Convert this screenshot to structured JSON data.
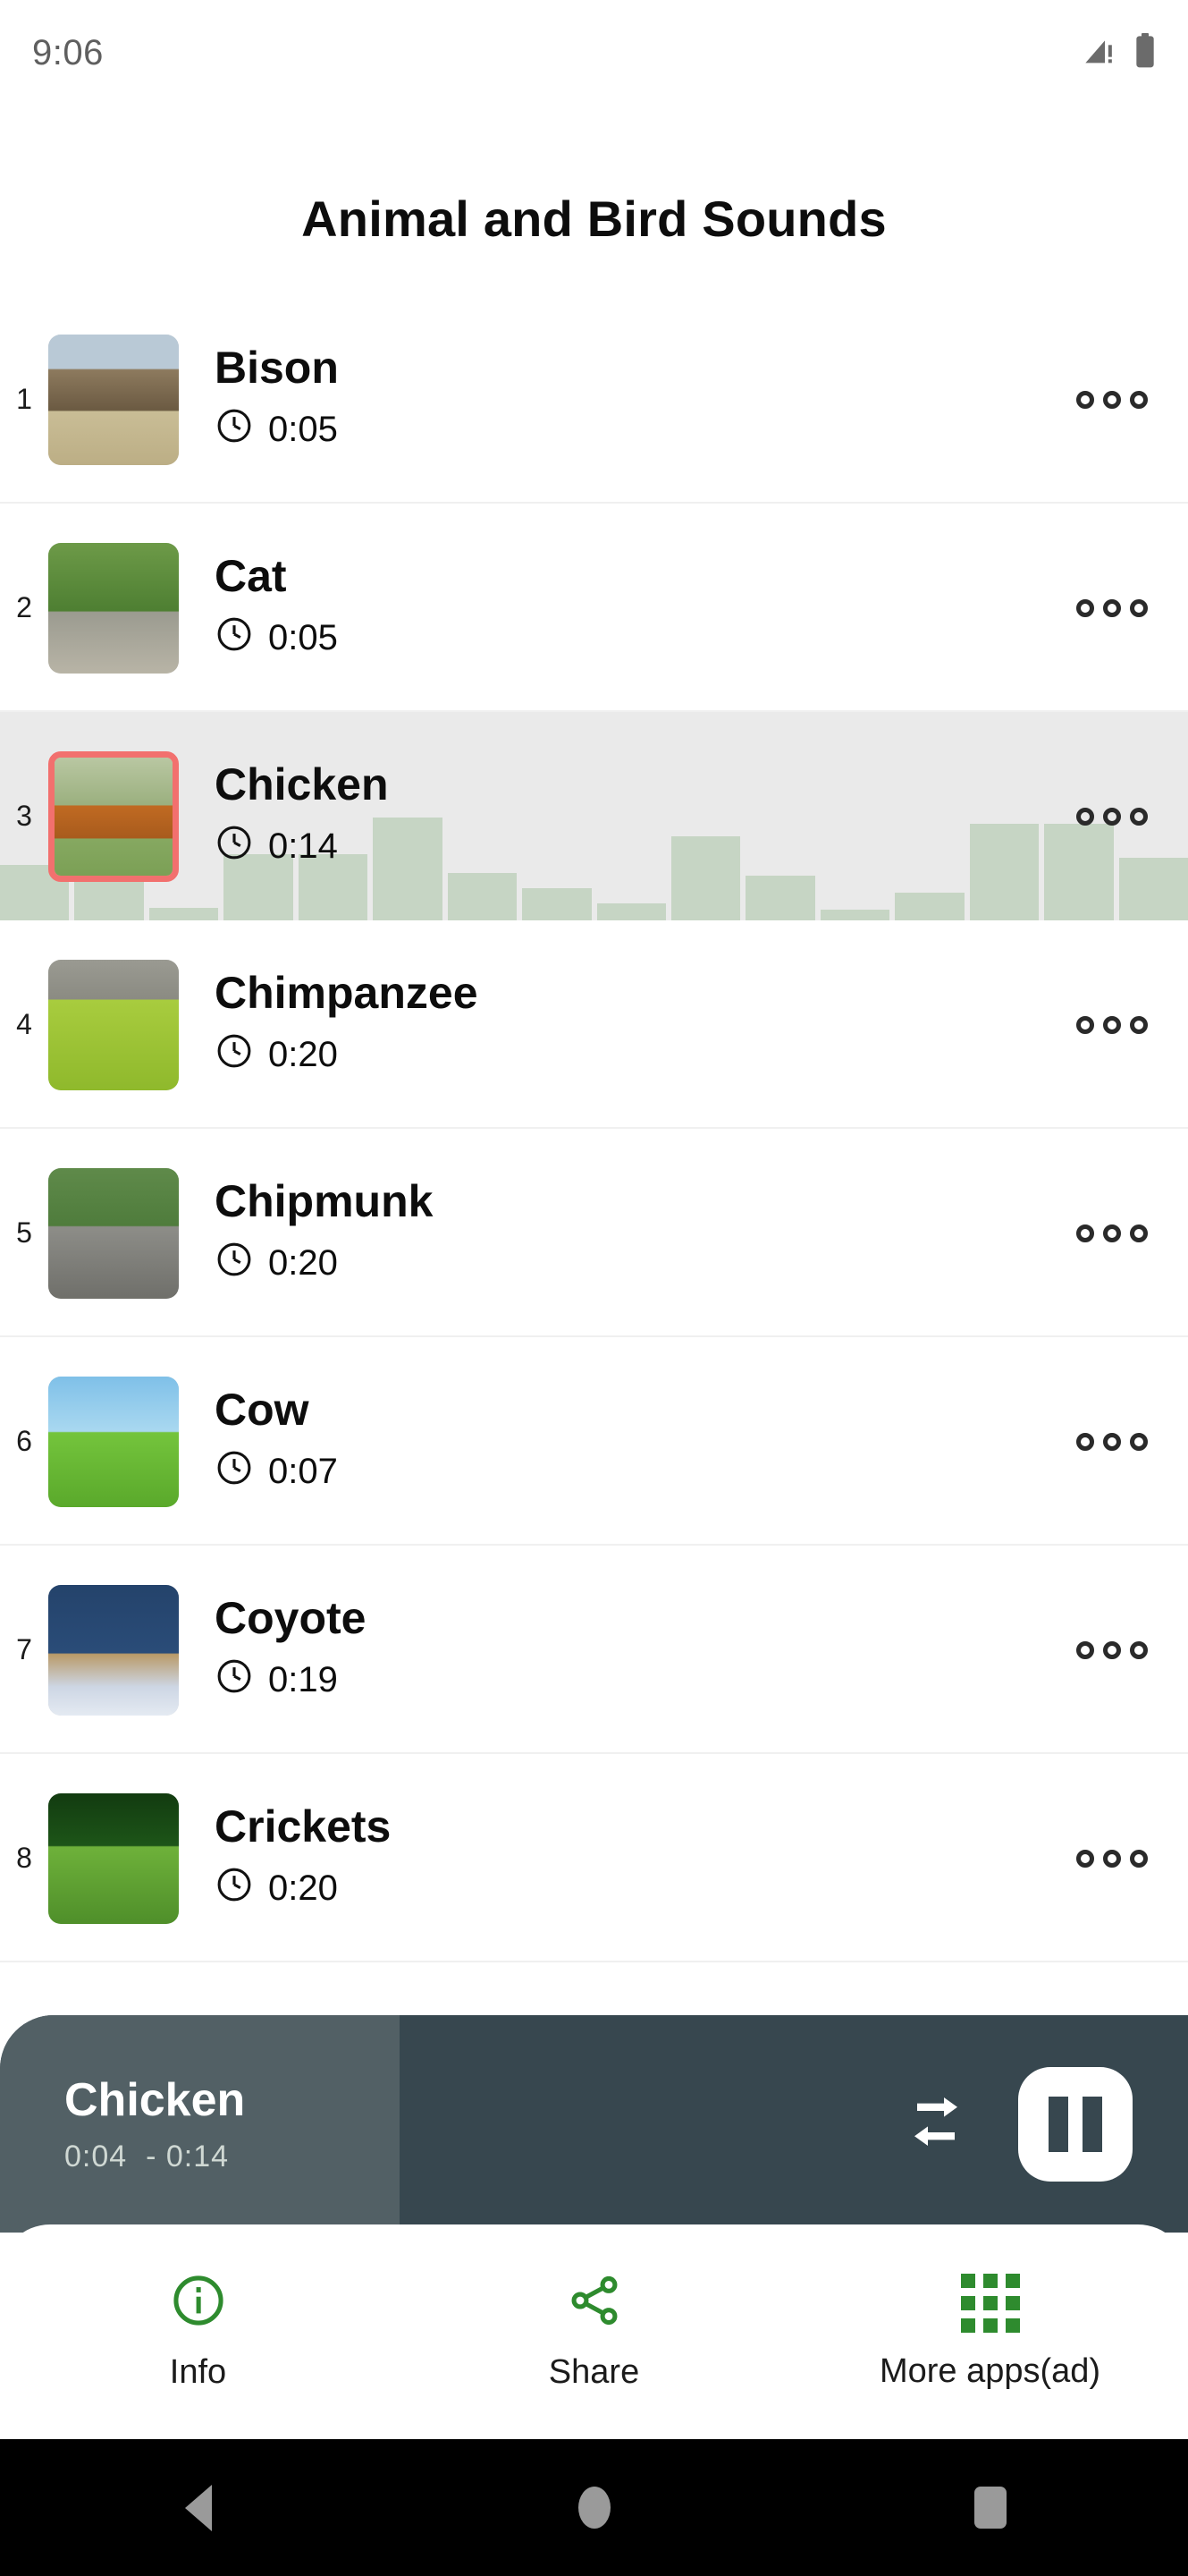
{
  "status_bar": {
    "time": "9:06",
    "signal_icon": "cellular-signal-warning-icon",
    "battery_icon": "battery-full-icon"
  },
  "header": {
    "title": "Animal and Bird Sounds"
  },
  "colors": {
    "accent_green": "#2e8b2e",
    "waveform": "#C6D5C4",
    "active_row_bg": "#EAEAEA",
    "selected_thumb_border": "#F2706E",
    "player_bg": "#37474F",
    "player_progress": "#526065"
  },
  "list": {
    "items": [
      {
        "index": "1",
        "name": "Bison",
        "duration": "0:05",
        "active": false,
        "thumb_alt": "bison-thumbnail"
      },
      {
        "index": "2",
        "name": "Cat",
        "duration": "0:05",
        "active": false,
        "thumb_alt": "cat-thumbnail"
      },
      {
        "index": "3",
        "name": "Chicken",
        "duration": "0:14",
        "active": true,
        "thumb_alt": "chicken-thumbnail"
      },
      {
        "index": "4",
        "name": "Chimpanzee",
        "duration": "0:20",
        "active": false,
        "thumb_alt": "chimpanzee-thumbnail"
      },
      {
        "index": "5",
        "name": "Chipmunk",
        "duration": "0:20",
        "active": false,
        "thumb_alt": "chipmunk-thumbnail"
      },
      {
        "index": "6",
        "name": "Cow",
        "duration": "0:07",
        "active": false,
        "thumb_alt": "cow-thumbnail"
      },
      {
        "index": "7",
        "name": "Coyote",
        "duration": "0:19",
        "active": false,
        "thumb_alt": "coyote-thumbnail"
      },
      {
        "index": "8",
        "name": "Crickets",
        "duration": "0:20",
        "active": false,
        "thumb_alt": "crickets-thumbnail"
      }
    ],
    "waveform_heights": [
      52,
      48,
      12,
      62,
      62,
      96,
      44,
      30,
      16,
      78,
      42,
      10,
      26,
      90,
      90,
      58
    ],
    "overflow_icon": "more-options-icon",
    "duration_icon": "clock-icon"
  },
  "player": {
    "track_title": "Chicken",
    "time_current": "0:04",
    "time_separator": "-",
    "time_total": "0:14",
    "progress_percent": 33.6,
    "repeat_icon": "repeat-icon",
    "playpause_icon": "pause-icon"
  },
  "bottom_nav": {
    "items": [
      {
        "label": "Info",
        "icon": "info-circle-icon"
      },
      {
        "label": "Share",
        "icon": "share-icon"
      },
      {
        "label": "More apps(ad)",
        "icon": "apps-grid-icon"
      }
    ]
  },
  "system_nav": {
    "back": "back-triangle-icon",
    "home": "home-circle-icon",
    "recents": "recents-square-icon"
  }
}
